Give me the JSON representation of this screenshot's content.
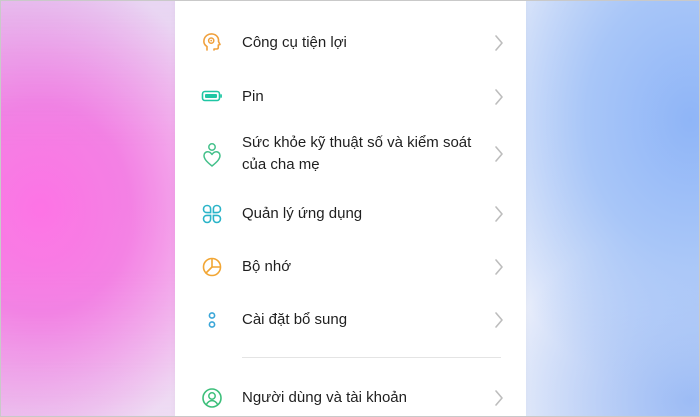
{
  "settings": {
    "items": [
      {
        "label": "Công cụ tiện lợi",
        "icon": "head-gear-icon"
      },
      {
        "label": "Pin",
        "icon": "battery-icon"
      },
      {
        "label_line1": "Sức khỏe kỹ thuật số và kiểm soát",
        "label_line2": "của cha mẹ",
        "icon": "heart-person-icon"
      },
      {
        "label": "Quản lý ứng dụng",
        "icon": "app-grid-icon"
      },
      {
        "label": "Bộ nhớ",
        "icon": "storage-pie-icon"
      },
      {
        "label": "Cài đặt bổ sung",
        "icon": "two-dots-icon"
      },
      {
        "label": "Người dùng và tài khoản",
        "icon": "user-icon"
      }
    ]
  },
  "colors": {
    "tools": "#f0a03c",
    "battery": "#1fc6a4",
    "wellbeing": "#43c08a",
    "apps": "#2ab4c8",
    "storage": "#f2a634",
    "additional": "#3aa6d8",
    "users": "#3cbf7a",
    "chevron": "#bdbdbd"
  }
}
